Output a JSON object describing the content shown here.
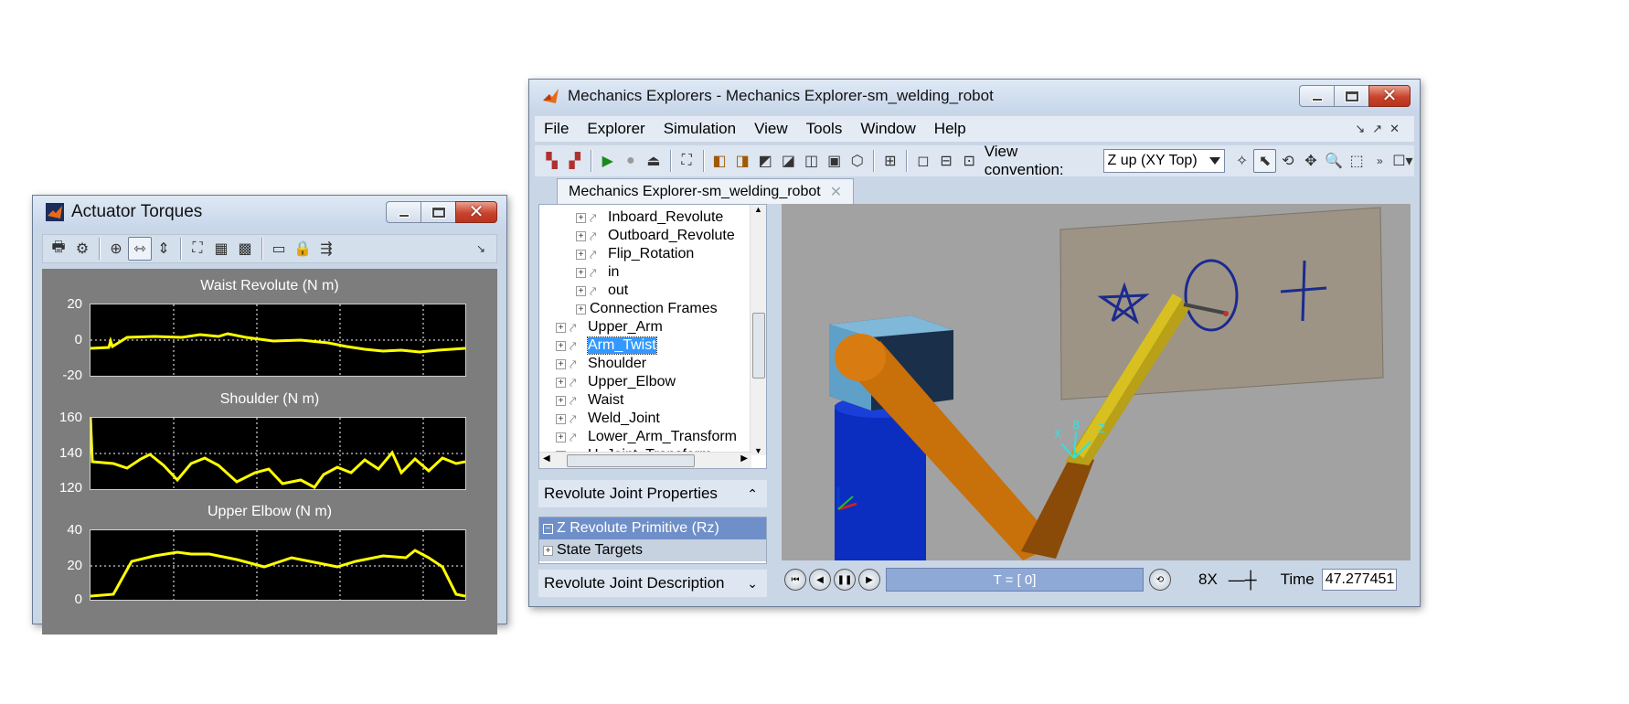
{
  "torques_window": {
    "title": "Actuator Torques",
    "toolbar_icons": [
      "print-icon",
      "gear-icon",
      "zoom-in-icon",
      "zoom-x-icon",
      "zoom-y-icon",
      "autoscale-icon",
      "save-axes-icon",
      "restore-axes-icon",
      "float-icon",
      "lock-icon",
      "cursor-icon"
    ],
    "plots": [
      {
        "title": "Waist Revolute (N m)",
        "yticks": [
          "20",
          "0",
          "-20"
        ]
      },
      {
        "title": "Shoulder (N m)",
        "yticks": [
          "160",
          "140",
          "120"
        ]
      },
      {
        "title": "Upper Elbow (N m)",
        "yticks": [
          "40",
          "20",
          "0"
        ]
      }
    ]
  },
  "mech_window": {
    "title": "Mechanics Explorers - Mechanics Explorer-sm_welding_robot",
    "menu": [
      "File",
      "Explorer",
      "Simulation",
      "View",
      "Tools",
      "Window",
      "Help"
    ],
    "view_convention_label": "View convention:",
    "view_convention_value": "Z up (XY Top)",
    "tab_label": "Mechanics Explorer-sm_welding_robot",
    "tree_items": [
      {
        "label": "Inboard_Revolute",
        "level": 2
      },
      {
        "label": "Outboard_Revolute",
        "level": 2
      },
      {
        "label": "Flip_Rotation",
        "level": 2
      },
      {
        "label": "in",
        "level": 2
      },
      {
        "label": "out",
        "level": 2
      },
      {
        "label": "Connection Frames",
        "level": 2
      },
      {
        "label": "Upper_Arm",
        "level": 1
      },
      {
        "label": "Arm_Twist",
        "level": 1,
        "selected": true
      },
      {
        "label": "Shoulder",
        "level": 1
      },
      {
        "label": "Upper_Elbow",
        "level": 1
      },
      {
        "label": "Waist",
        "level": 1
      },
      {
        "label": "Weld_Joint",
        "level": 1
      },
      {
        "label": "Lower_Arm_Transform",
        "level": 1
      },
      {
        "label": "U_Joint_Transform",
        "level": 1
      }
    ],
    "prop_header": "Revolute Joint Properties",
    "prop_rows": [
      "Z Revolute Primitive (Rz)",
      "State Targets"
    ],
    "desc_header": "Revolute Joint Description",
    "timebar_text": "T = [ 0]",
    "speed": "8X",
    "time_label": "Time",
    "time_value": "47.277451"
  }
}
